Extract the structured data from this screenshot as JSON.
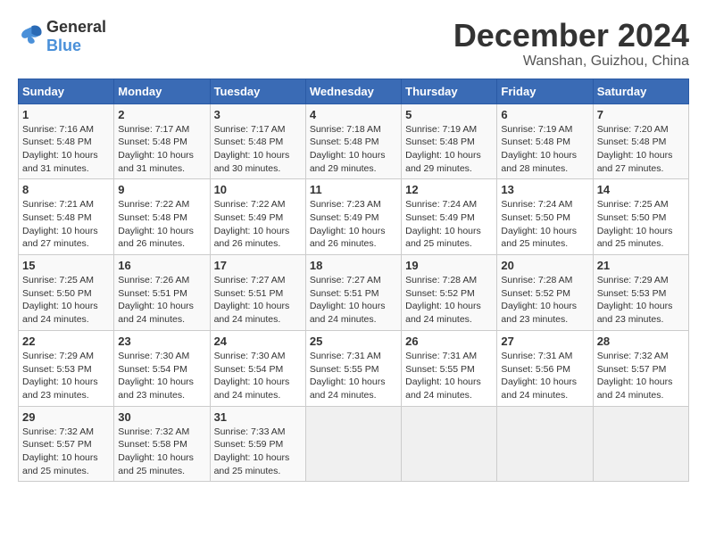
{
  "header": {
    "logo_general": "General",
    "logo_blue": "Blue",
    "title": "December 2024",
    "subtitle": "Wanshan, Guizhou, China"
  },
  "days_of_week": [
    "Sunday",
    "Monday",
    "Tuesday",
    "Wednesday",
    "Thursday",
    "Friday",
    "Saturday"
  ],
  "weeks": [
    [
      {
        "day": "1",
        "info": "Sunrise: 7:16 AM\nSunset: 5:48 PM\nDaylight: 10 hours\nand 31 minutes."
      },
      {
        "day": "2",
        "info": "Sunrise: 7:17 AM\nSunset: 5:48 PM\nDaylight: 10 hours\nand 31 minutes."
      },
      {
        "day": "3",
        "info": "Sunrise: 7:17 AM\nSunset: 5:48 PM\nDaylight: 10 hours\nand 30 minutes."
      },
      {
        "day": "4",
        "info": "Sunrise: 7:18 AM\nSunset: 5:48 PM\nDaylight: 10 hours\nand 29 minutes."
      },
      {
        "day": "5",
        "info": "Sunrise: 7:19 AM\nSunset: 5:48 PM\nDaylight: 10 hours\nand 29 minutes."
      },
      {
        "day": "6",
        "info": "Sunrise: 7:19 AM\nSunset: 5:48 PM\nDaylight: 10 hours\nand 28 minutes."
      },
      {
        "day": "7",
        "info": "Sunrise: 7:20 AM\nSunset: 5:48 PM\nDaylight: 10 hours\nand 27 minutes."
      }
    ],
    [
      {
        "day": "8",
        "info": "Sunrise: 7:21 AM\nSunset: 5:48 PM\nDaylight: 10 hours\nand 27 minutes."
      },
      {
        "day": "9",
        "info": "Sunrise: 7:22 AM\nSunset: 5:48 PM\nDaylight: 10 hours\nand 26 minutes."
      },
      {
        "day": "10",
        "info": "Sunrise: 7:22 AM\nSunset: 5:49 PM\nDaylight: 10 hours\nand 26 minutes."
      },
      {
        "day": "11",
        "info": "Sunrise: 7:23 AM\nSunset: 5:49 PM\nDaylight: 10 hours\nand 26 minutes."
      },
      {
        "day": "12",
        "info": "Sunrise: 7:24 AM\nSunset: 5:49 PM\nDaylight: 10 hours\nand 25 minutes."
      },
      {
        "day": "13",
        "info": "Sunrise: 7:24 AM\nSunset: 5:50 PM\nDaylight: 10 hours\nand 25 minutes."
      },
      {
        "day": "14",
        "info": "Sunrise: 7:25 AM\nSunset: 5:50 PM\nDaylight: 10 hours\nand 25 minutes."
      }
    ],
    [
      {
        "day": "15",
        "info": "Sunrise: 7:25 AM\nSunset: 5:50 PM\nDaylight: 10 hours\nand 24 minutes."
      },
      {
        "day": "16",
        "info": "Sunrise: 7:26 AM\nSunset: 5:51 PM\nDaylight: 10 hours\nand 24 minutes."
      },
      {
        "day": "17",
        "info": "Sunrise: 7:27 AM\nSunset: 5:51 PM\nDaylight: 10 hours\nand 24 minutes."
      },
      {
        "day": "18",
        "info": "Sunrise: 7:27 AM\nSunset: 5:51 PM\nDaylight: 10 hours\nand 24 minutes."
      },
      {
        "day": "19",
        "info": "Sunrise: 7:28 AM\nSunset: 5:52 PM\nDaylight: 10 hours\nand 24 minutes."
      },
      {
        "day": "20",
        "info": "Sunrise: 7:28 AM\nSunset: 5:52 PM\nDaylight: 10 hours\nand 23 minutes."
      },
      {
        "day": "21",
        "info": "Sunrise: 7:29 AM\nSunset: 5:53 PM\nDaylight: 10 hours\nand 23 minutes."
      }
    ],
    [
      {
        "day": "22",
        "info": "Sunrise: 7:29 AM\nSunset: 5:53 PM\nDaylight: 10 hours\nand 23 minutes."
      },
      {
        "day": "23",
        "info": "Sunrise: 7:30 AM\nSunset: 5:54 PM\nDaylight: 10 hours\nand 23 minutes."
      },
      {
        "day": "24",
        "info": "Sunrise: 7:30 AM\nSunset: 5:54 PM\nDaylight: 10 hours\nand 24 minutes."
      },
      {
        "day": "25",
        "info": "Sunrise: 7:31 AM\nSunset: 5:55 PM\nDaylight: 10 hours\nand 24 minutes."
      },
      {
        "day": "26",
        "info": "Sunrise: 7:31 AM\nSunset: 5:55 PM\nDaylight: 10 hours\nand 24 minutes."
      },
      {
        "day": "27",
        "info": "Sunrise: 7:31 AM\nSunset: 5:56 PM\nDaylight: 10 hours\nand 24 minutes."
      },
      {
        "day": "28",
        "info": "Sunrise: 7:32 AM\nSunset: 5:57 PM\nDaylight: 10 hours\nand 24 minutes."
      }
    ],
    [
      {
        "day": "29",
        "info": "Sunrise: 7:32 AM\nSunset: 5:57 PM\nDaylight: 10 hours\nand 25 minutes."
      },
      {
        "day": "30",
        "info": "Sunrise: 7:32 AM\nSunset: 5:58 PM\nDaylight: 10 hours\nand 25 minutes."
      },
      {
        "day": "31",
        "info": "Sunrise: 7:33 AM\nSunset: 5:59 PM\nDaylight: 10 hours\nand 25 minutes."
      },
      null,
      null,
      null,
      null
    ]
  ]
}
